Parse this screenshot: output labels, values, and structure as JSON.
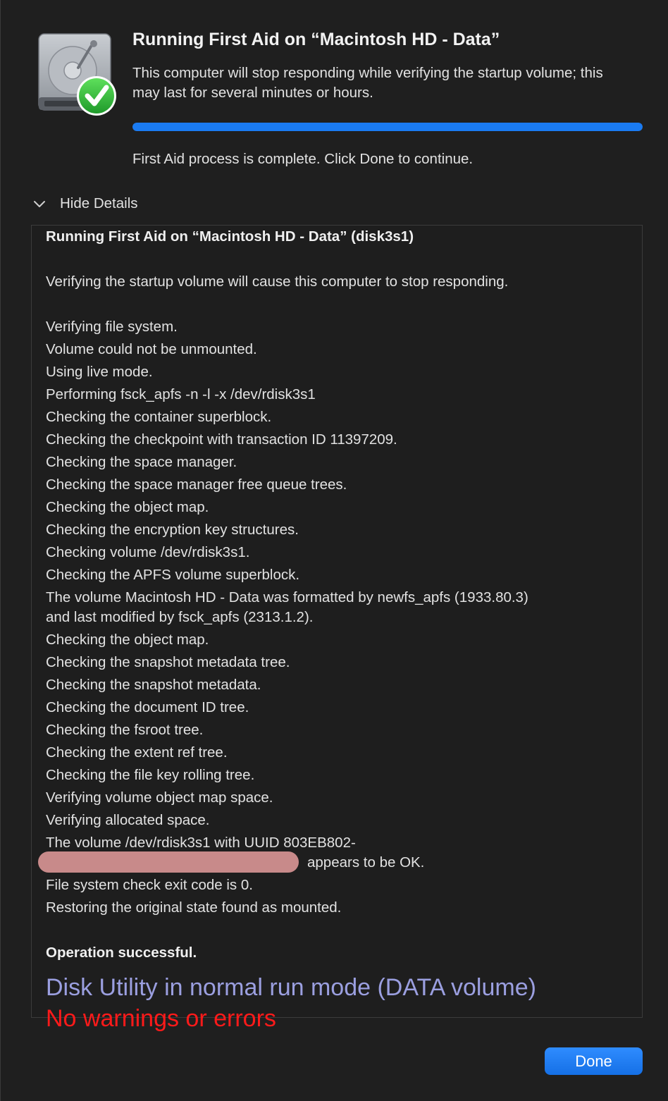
{
  "dialog": {
    "title": "Running First Aid on “Macintosh HD - Data”",
    "subtitle": "This computer will stop responding while verifying the startup volume; this may last for several minutes or hours.",
    "progress_percent": 100,
    "status": "First Aid process is complete. Click Done to continue.",
    "toggle_label": "Hide Details",
    "done_label": "Done",
    "accent_color": "#1a7bf2"
  },
  "log": {
    "heading": "Running First Aid on “Macintosh HD - Data” (disk3s1)",
    "lines": [
      "Verifying the startup volume will cause this computer to stop responding.",
      "Verifying file system.",
      "Volume could not be unmounted.",
      "Using live mode.",
      "Performing fsck_apfs -n -l -x /dev/rdisk3s1",
      "Checking the container superblock.",
      "Checking the checkpoint with transaction ID 11397209.",
      "Checking the space manager.",
      "Checking the space manager free queue trees.",
      "Checking the object map.",
      "Checking the encryption key structures.",
      "Checking volume /dev/rdisk3s1.",
      "Checking the APFS volume superblock.",
      "The volume Macintosh HD - Data was formatted by newfs_apfs (1933.80.3)",
      "and last modified by fsck_apfs (2313.1.2).",
      "Checking the object map.",
      "Checking the snapshot metadata tree.",
      "Checking the snapshot metadata.",
      "Checking the document ID tree.",
      "Checking the fsroot tree.",
      "Checking the extent ref tree.",
      "Checking the file key rolling tree.",
      "Verifying volume object map space.",
      "Verifying allocated space.",
      "The volume /dev/rdisk3s1 with UUID 803EB802-",
      "appears to be OK.",
      "File system check exit code is 0.",
      "Restoring the original state found as mounted."
    ],
    "result": "Operation successful."
  },
  "annotations": {
    "blue_text": "Disk Utility in normal run mode (DATA volume)",
    "red_text": "No warnings or errors",
    "blue_color": "#9b9fe0",
    "red_color": "#ff1a1a"
  },
  "icons": {
    "disk": "hard-disk-icon",
    "check": "green-checkmark-icon",
    "chevron": "chevron-down-icon"
  }
}
